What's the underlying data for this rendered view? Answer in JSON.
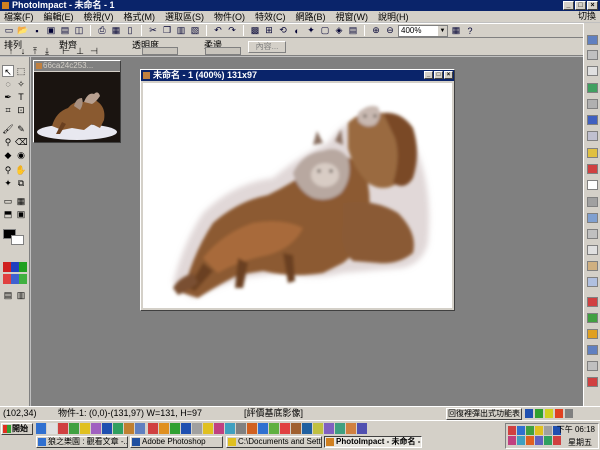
{
  "window": {
    "title": "PhotoImpact - 未命名 - 1"
  },
  "menubar": {
    "items": [
      "檔案(F)",
      "編輯(E)",
      "檢視(V)",
      "格式(M)",
      "選取區(S)",
      "物件(O)",
      "特效(C)",
      "網路(B)",
      "視窗(W)",
      "說明(H)"
    ],
    "right_label": "切換"
  },
  "toolbar": {
    "zoom_value": "400%"
  },
  "attrbar": {
    "arrange_label": "排列",
    "align_label": "對齊",
    "opacity_label": "透明度",
    "softedge_label": "柔邊",
    "properties_button": "內容..."
  },
  "thumbnail_window": {
    "title": "66ca24c253..."
  },
  "image_window": {
    "title": "未命名 - 1 (400%) 131x97"
  },
  "statusbar": {
    "coords": "(102,34)",
    "object_info": "物件-1: (0,0)-(131,97) W=131, H=97",
    "hint": "[評價基底影像]",
    "button_label": "回復裡彈出式功能表"
  },
  "taskbar": {
    "start_label": "開始",
    "tasks": [
      {
        "label": "狼之樂園 : 觀看文章 -..."
      },
      {
        "label": "Adobe Photoshop"
      },
      {
        "label": "C:\\Documents and Setting..."
      },
      {
        "label": "PhotoImpact - 未命名 - 1"
      }
    ],
    "clock": "下午 06:18",
    "day": "星期五"
  },
  "colors": {
    "title_active": "#0a246a",
    "face": "#d4d0c8",
    "workspace": "#808080"
  }
}
